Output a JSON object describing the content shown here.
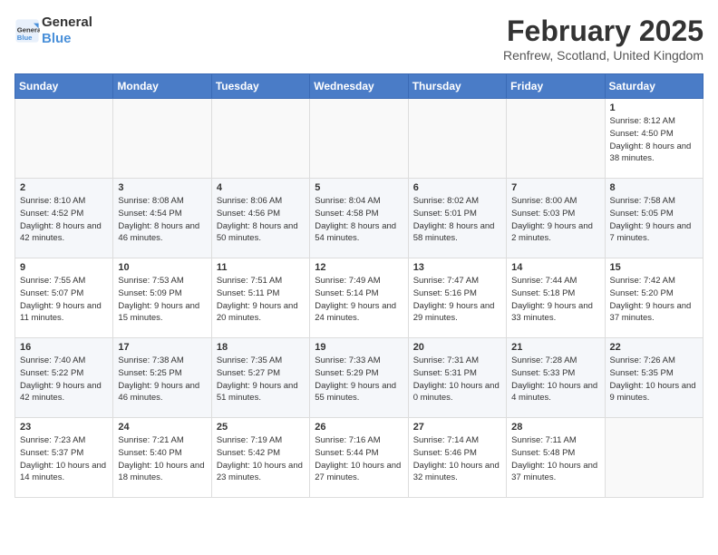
{
  "header": {
    "logo_line1": "General",
    "logo_line2": "Blue",
    "month_title": "February 2025",
    "location": "Renfrew, Scotland, United Kingdom"
  },
  "weekdays": [
    "Sunday",
    "Monday",
    "Tuesday",
    "Wednesday",
    "Thursday",
    "Friday",
    "Saturday"
  ],
  "weeks": [
    [
      {
        "day": "",
        "info": ""
      },
      {
        "day": "",
        "info": ""
      },
      {
        "day": "",
        "info": ""
      },
      {
        "day": "",
        "info": ""
      },
      {
        "day": "",
        "info": ""
      },
      {
        "day": "",
        "info": ""
      },
      {
        "day": "1",
        "info": "Sunrise: 8:12 AM\nSunset: 4:50 PM\nDaylight: 8 hours and 38 minutes."
      }
    ],
    [
      {
        "day": "2",
        "info": "Sunrise: 8:10 AM\nSunset: 4:52 PM\nDaylight: 8 hours and 42 minutes."
      },
      {
        "day": "3",
        "info": "Sunrise: 8:08 AM\nSunset: 4:54 PM\nDaylight: 8 hours and 46 minutes."
      },
      {
        "day": "4",
        "info": "Sunrise: 8:06 AM\nSunset: 4:56 PM\nDaylight: 8 hours and 50 minutes."
      },
      {
        "day": "5",
        "info": "Sunrise: 8:04 AM\nSunset: 4:58 PM\nDaylight: 8 hours and 54 minutes."
      },
      {
        "day": "6",
        "info": "Sunrise: 8:02 AM\nSunset: 5:01 PM\nDaylight: 8 hours and 58 minutes."
      },
      {
        "day": "7",
        "info": "Sunrise: 8:00 AM\nSunset: 5:03 PM\nDaylight: 9 hours and 2 minutes."
      },
      {
        "day": "8",
        "info": "Sunrise: 7:58 AM\nSunset: 5:05 PM\nDaylight: 9 hours and 7 minutes."
      }
    ],
    [
      {
        "day": "9",
        "info": "Sunrise: 7:55 AM\nSunset: 5:07 PM\nDaylight: 9 hours and 11 minutes."
      },
      {
        "day": "10",
        "info": "Sunrise: 7:53 AM\nSunset: 5:09 PM\nDaylight: 9 hours and 15 minutes."
      },
      {
        "day": "11",
        "info": "Sunrise: 7:51 AM\nSunset: 5:11 PM\nDaylight: 9 hours and 20 minutes."
      },
      {
        "day": "12",
        "info": "Sunrise: 7:49 AM\nSunset: 5:14 PM\nDaylight: 9 hours and 24 minutes."
      },
      {
        "day": "13",
        "info": "Sunrise: 7:47 AM\nSunset: 5:16 PM\nDaylight: 9 hours and 29 minutes."
      },
      {
        "day": "14",
        "info": "Sunrise: 7:44 AM\nSunset: 5:18 PM\nDaylight: 9 hours and 33 minutes."
      },
      {
        "day": "15",
        "info": "Sunrise: 7:42 AM\nSunset: 5:20 PM\nDaylight: 9 hours and 37 minutes."
      }
    ],
    [
      {
        "day": "16",
        "info": "Sunrise: 7:40 AM\nSunset: 5:22 PM\nDaylight: 9 hours and 42 minutes."
      },
      {
        "day": "17",
        "info": "Sunrise: 7:38 AM\nSunset: 5:25 PM\nDaylight: 9 hours and 46 minutes."
      },
      {
        "day": "18",
        "info": "Sunrise: 7:35 AM\nSunset: 5:27 PM\nDaylight: 9 hours and 51 minutes."
      },
      {
        "day": "19",
        "info": "Sunrise: 7:33 AM\nSunset: 5:29 PM\nDaylight: 9 hours and 55 minutes."
      },
      {
        "day": "20",
        "info": "Sunrise: 7:31 AM\nSunset: 5:31 PM\nDaylight: 10 hours and 0 minutes."
      },
      {
        "day": "21",
        "info": "Sunrise: 7:28 AM\nSunset: 5:33 PM\nDaylight: 10 hours and 4 minutes."
      },
      {
        "day": "22",
        "info": "Sunrise: 7:26 AM\nSunset: 5:35 PM\nDaylight: 10 hours and 9 minutes."
      }
    ],
    [
      {
        "day": "23",
        "info": "Sunrise: 7:23 AM\nSunset: 5:37 PM\nDaylight: 10 hours and 14 minutes."
      },
      {
        "day": "24",
        "info": "Sunrise: 7:21 AM\nSunset: 5:40 PM\nDaylight: 10 hours and 18 minutes."
      },
      {
        "day": "25",
        "info": "Sunrise: 7:19 AM\nSunset: 5:42 PM\nDaylight: 10 hours and 23 minutes."
      },
      {
        "day": "26",
        "info": "Sunrise: 7:16 AM\nSunset: 5:44 PM\nDaylight: 10 hours and 27 minutes."
      },
      {
        "day": "27",
        "info": "Sunrise: 7:14 AM\nSunset: 5:46 PM\nDaylight: 10 hours and 32 minutes."
      },
      {
        "day": "28",
        "info": "Sunrise: 7:11 AM\nSunset: 5:48 PM\nDaylight: 10 hours and 37 minutes."
      },
      {
        "day": "",
        "info": ""
      }
    ]
  ]
}
